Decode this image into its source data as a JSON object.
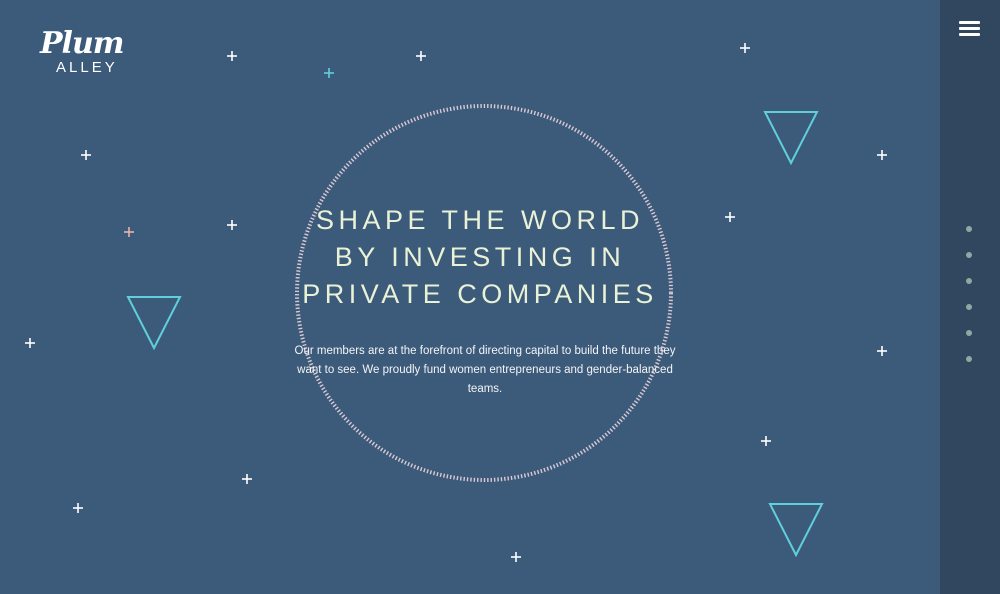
{
  "brand": {
    "logo_script": "Plum",
    "logo_sub": "ALLEY"
  },
  "hero": {
    "headline_lines": [
      "SHAPE THE WORLD",
      "BY INVESTING IN",
      "PRIVATE COMPANIES"
    ],
    "description": "Our members are at the forefront of directing capital to build the future they want to see. We proudly fund women entrepreneurs and gender-balanced teams."
  },
  "nav": {
    "menu_icon": "hamburger-icon",
    "section_dot_count": 6
  },
  "colors": {
    "background": "#3c5a7a",
    "rail": "#31465f",
    "headline": "#e9f1d6",
    "triangle": "#5fd0db",
    "circle": "#d9c9d4",
    "plus_white": "#ffffff",
    "plus_teal": "#5fd0db",
    "plus_pink": "#e7b4a8",
    "dot": "#8fa7a5"
  }
}
